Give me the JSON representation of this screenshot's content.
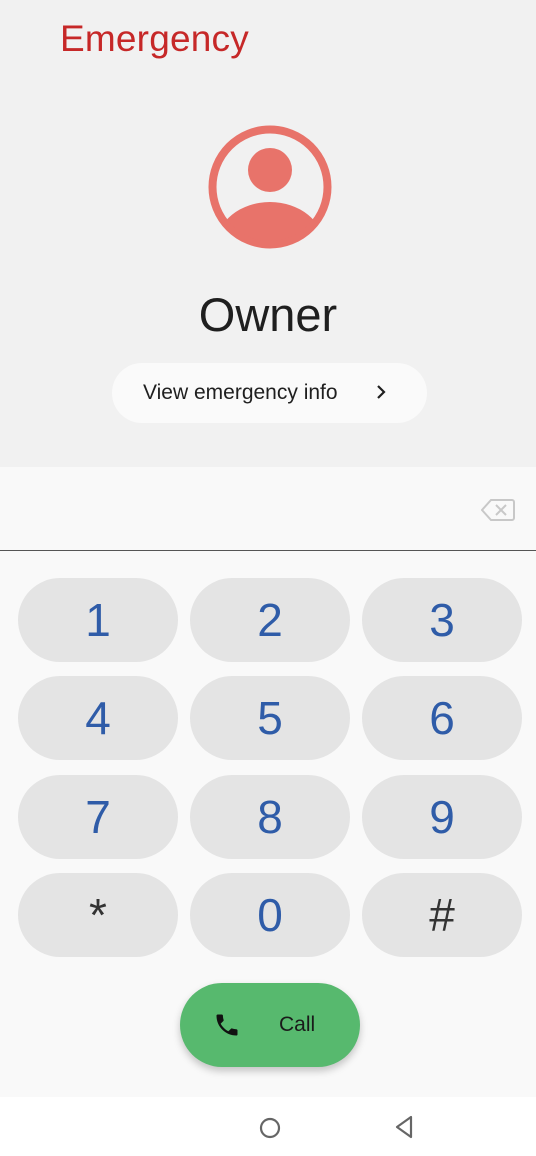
{
  "header": {
    "title": "Emergency"
  },
  "profile": {
    "name": "Owner",
    "info_button_label": "View emergency info"
  },
  "dialpad": {
    "keys": [
      "1",
      "2",
      "3",
      "4",
      "5",
      "6",
      "7",
      "8",
      "9",
      "*",
      "0",
      "#"
    ]
  },
  "call_button": {
    "label": "Call"
  },
  "colors": {
    "title": "#c62828",
    "avatar": "#e8736a",
    "digits": "#2f5ca8",
    "call": "#57b96e"
  },
  "icons": [
    "avatar-icon",
    "chevron-right-icon",
    "backspace-icon",
    "phone-icon",
    "home-circle-icon",
    "back-triangle-icon"
  ]
}
